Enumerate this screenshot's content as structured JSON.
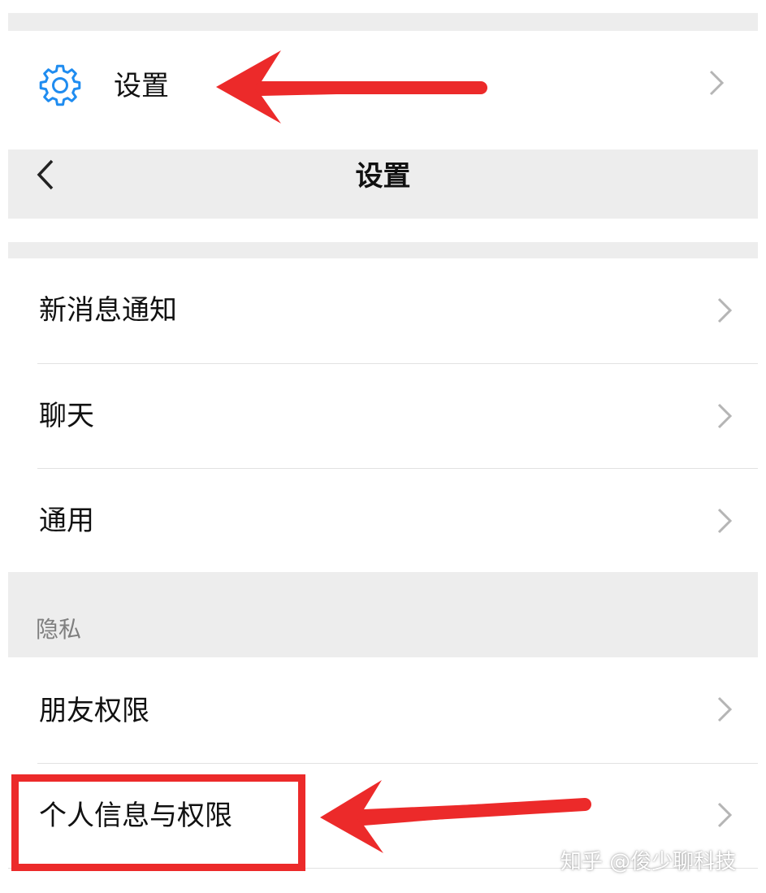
{
  "settings_entry": {
    "label": "设置",
    "icon": "gear-icon"
  },
  "navbar": {
    "back_icon": "chevron-left-icon",
    "title": "设置"
  },
  "list_items": [
    {
      "label": "新消息通知"
    },
    {
      "label": "聊天"
    },
    {
      "label": "通用"
    }
  ],
  "privacy": {
    "header": "隐私",
    "items": [
      {
        "label": "朋友权限"
      },
      {
        "label": "个人信息与权限"
      }
    ]
  },
  "watermark": "知乎 @俊少聊科技",
  "colors": {
    "accent_blue": "#1f8cf0",
    "annotation_red": "#ec2a2a",
    "section_gray": "#ededed",
    "chevron_gray": "#b5b5b5"
  }
}
